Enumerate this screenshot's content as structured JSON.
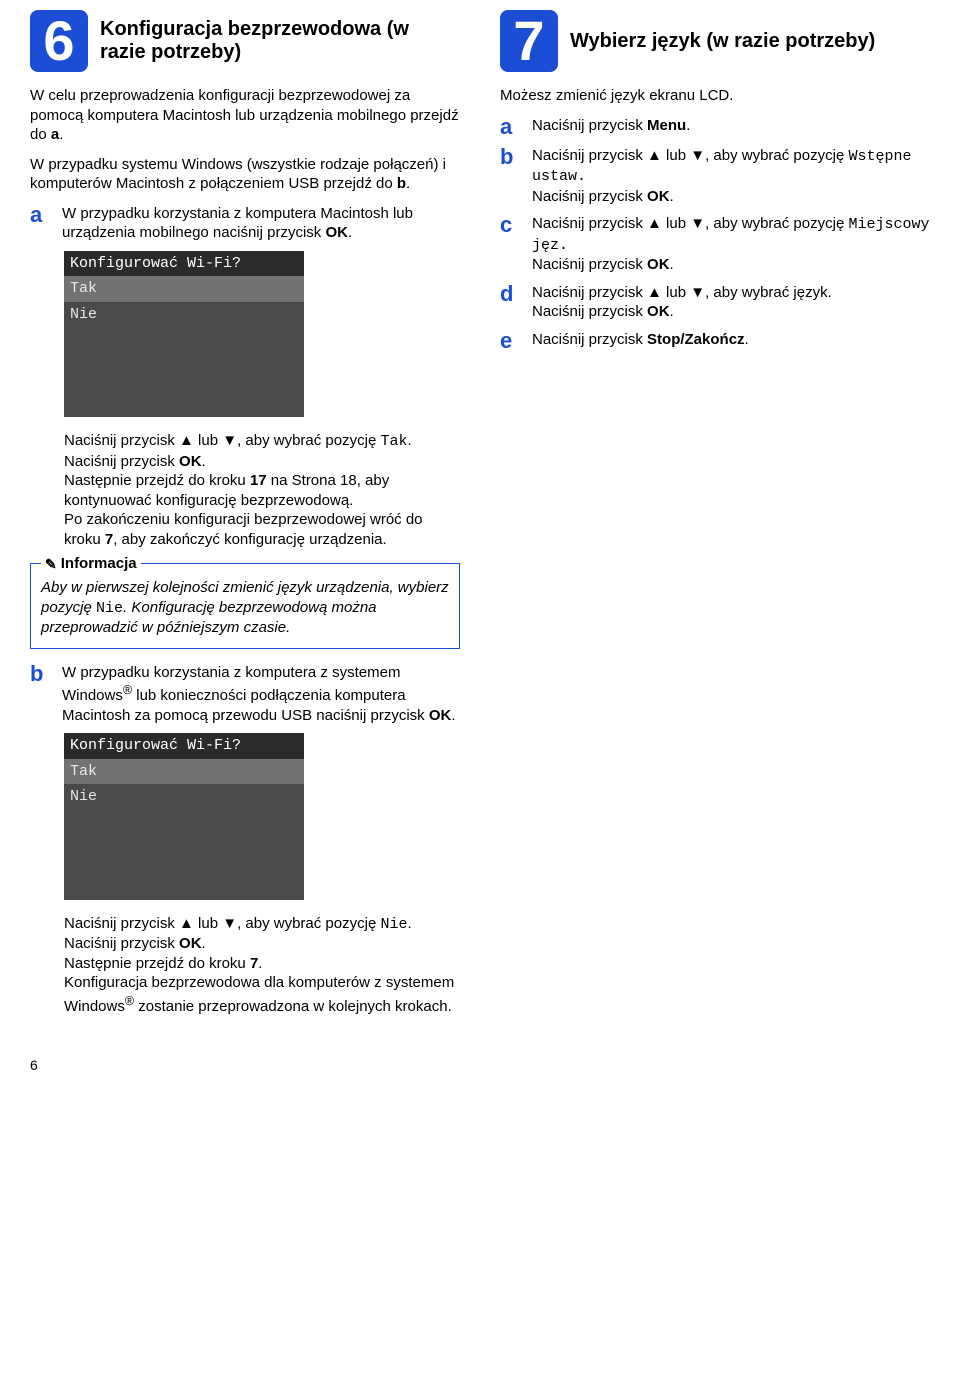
{
  "left": {
    "num": "6",
    "title": "Konfiguracja bezprzewodowa (w razie potrzeby)",
    "intro1": "W celu przeprowadzenia konfiguracji bezprzewodowej za pomocą komputera Macintosh lub urządzenia mobilnego przejdź do ",
    "intro1_bold": "a",
    "intro1_end": ".",
    "intro2": "W przypadku systemu Windows (wszystkie rodzaje połączeń) i komputerów Macintosh z połączeniem USB przejdź do ",
    "intro2_bold": "b",
    "intro2_end": ".",
    "a_letter": "a",
    "a_text": "W przypadku korzystania z komputera Macintosh lub urządzenia mobilnego naciśnij przycisk ",
    "a_bold": "OK",
    "a_end": ".",
    "lcd1": {
      "title": "Konfigurować Wi-Fi?",
      "row1": "Tak",
      "row2": "Nie"
    },
    "a_after1_pre": "Naciśnij przycisk ▲ lub ▼, aby wybrać pozycję ",
    "a_after1_mono": "Tak",
    "a_after1_post": ".",
    "a_after2_pre": "Naciśnij przycisk ",
    "a_after2_bold": "OK",
    "a_after2_post": ".",
    "a_after3_pre": "Następnie przejdź do kroku ",
    "a_after3_b1": "17",
    "a_after3_mid": " na Strona 18, aby kontynuować konfigurację bezprzewodową.",
    "a_after4_pre": "Po zakończeniu konfiguracji bezprzewodowej wróć do kroku ",
    "a_after4_b": "7",
    "a_after4_post": ", aby zakończyć konfigurację urządzenia.",
    "info_label": "Informacja",
    "info_text_pre": "Aby w pierwszej kolejności zmienić język urządzenia, wybierz pozycję ",
    "info_text_mono": "Nie",
    "info_text_post": ". Konfigurację bezprzewodową można przeprowadzić w późniejszym czasie.",
    "b_letter": "b",
    "b_text_pre": "W przypadku korzystania z komputera z systemem Windows",
    "b_sup": "®",
    "b_text_mid": " lub konieczności podłączenia komputera Macintosh za pomocą przewodu USB naciśnij przycisk ",
    "b_text_bold": "OK",
    "b_text_post": ".",
    "lcd2": {
      "title": "Konfigurować Wi-Fi?",
      "row1": "Tak",
      "row2": "Nie"
    },
    "b_after1_pre": "Naciśnij przycisk ▲ lub ▼, aby wybrać pozycję ",
    "b_after1_mono": "Nie",
    "b_after1_post": ".",
    "b_after2_pre": "Naciśnij przycisk ",
    "b_after2_bold": "OK",
    "b_after2_post": ".",
    "b_after3_pre": "Następnie przejdź do kroku ",
    "b_after3_bold": "7",
    "b_after3_post": ".",
    "b_after4_pre": "Konfiguracja bezprzewodowa dla komputerów z systemem Windows",
    "b_after4_sup": "®",
    "b_after4_post": " zostanie przeprowadzona w kolejnych krokach."
  },
  "right": {
    "num": "7",
    "title": "Wybierz język (w razie potrzeby)",
    "intro": "Możesz zmienić język ekranu LCD.",
    "a_letter": "a",
    "a_pre": "Naciśnij przycisk ",
    "a_bold": "Menu",
    "a_post": ".",
    "b_letter": "b",
    "b_pre": "Naciśnij przycisk ▲ lub ▼, aby wybrać pozycję ",
    "b_mono": "Wstępne ustaw.",
    "b2_pre": "Naciśnij przycisk ",
    "b2_bold": "OK",
    "b2_post": ".",
    "c_letter": "c",
    "c_pre": "Naciśnij przycisk ▲ lub ▼, aby wybrać pozycję ",
    "c_mono": "Miejscowy jęz.",
    "c2_pre": "Naciśnij przycisk ",
    "c2_bold": "OK",
    "c2_post": ".",
    "d_letter": "d",
    "d_pre": "Naciśnij przycisk ▲ lub ▼, aby wybrać język.",
    "d2_pre": "Naciśnij przycisk ",
    "d2_bold": "OK",
    "d2_post": ".",
    "e_letter": "e",
    "e_pre": "Naciśnij przycisk ",
    "e_bold": "Stop/Zakończ",
    "e_post": "."
  },
  "page": "6"
}
